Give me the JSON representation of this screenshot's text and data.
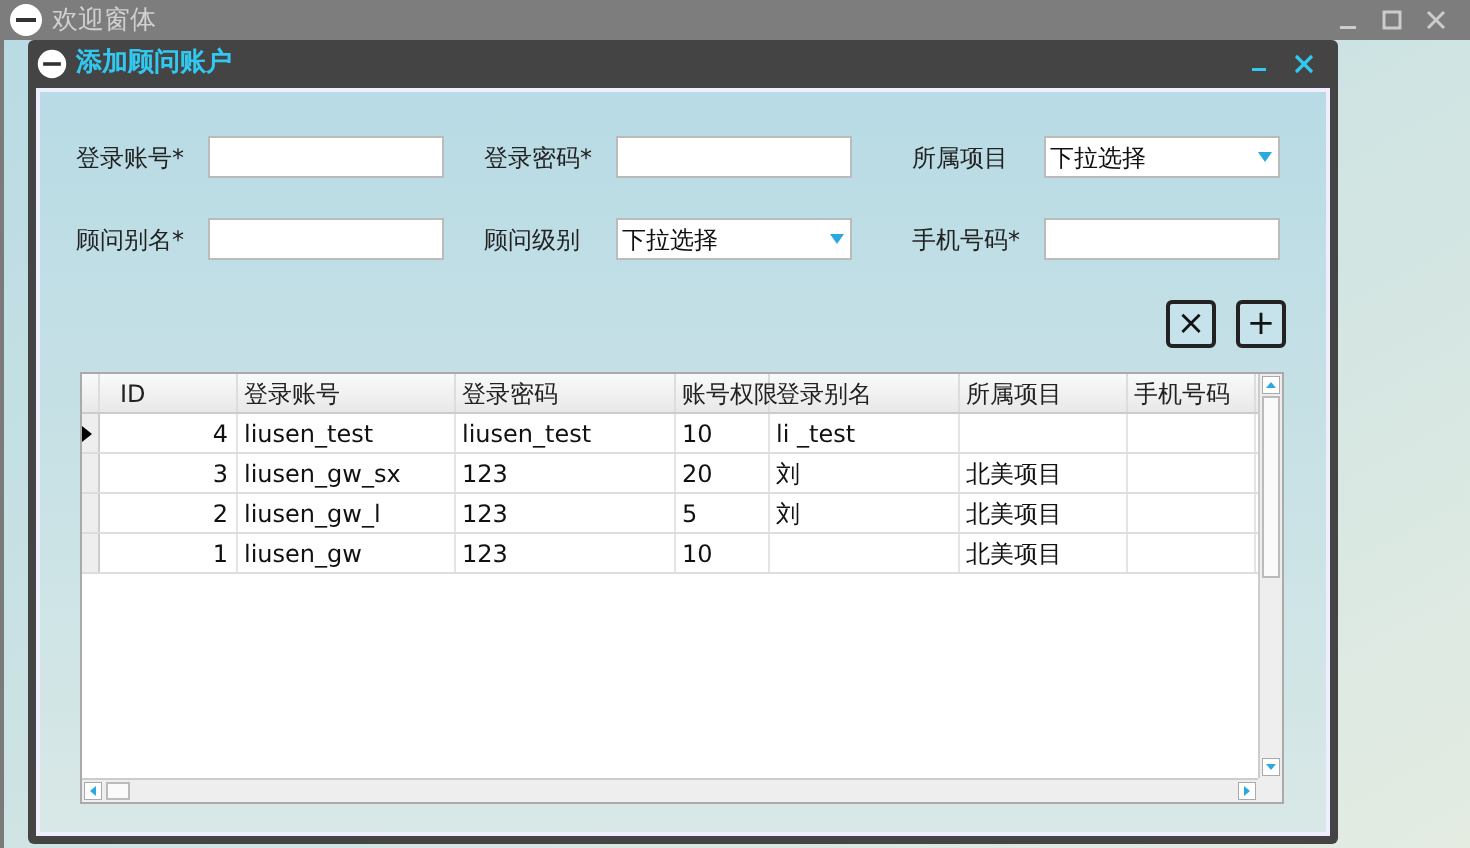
{
  "main_window": {
    "title": "欢迎窗体"
  },
  "dialog": {
    "title": "添加顾问账户"
  },
  "form_fields": [
    {
      "label": "登录账号*",
      "kind": "text"
    },
    {
      "label": "登录密码*",
      "kind": "text"
    },
    {
      "label": "所属项目",
      "kind": "dropdown",
      "value": "下拉选择"
    },
    {
      "label": "顾问别名*",
      "kind": "text"
    },
    {
      "label": "顾问级别",
      "kind": "dropdown",
      "value": "下拉选择"
    },
    {
      "label": "手机号码*",
      "kind": "text"
    }
  ],
  "action_buttons": [
    {
      "glyph": "×"
    },
    {
      "glyph": "+"
    }
  ],
  "table": {
    "columns": [
      "ID",
      "登录账号",
      "登录密码",
      "账号权限",
      "登录别名",
      "所属项目",
      "手机号码"
    ],
    "rows": [
      {
        "current": true,
        "cells": [
          "4",
          "liusen_test",
          "liusen_test",
          "10",
          "li _test",
          "",
          ""
        ]
      },
      {
        "current": false,
        "cells": [
          "3",
          "liusen_gw_sx",
          "123",
          "20",
          "刘",
          "北美项目",
          ""
        ]
      },
      {
        "current": false,
        "cells": [
          "2",
          "liusen_gw_l",
          "123",
          "5",
          "刘",
          "北美项目",
          ""
        ]
      },
      {
        "current": false,
        "cells": [
          "1",
          "liusen_gw",
          "123",
          "10",
          "",
          "北美项目",
          ""
        ]
      }
    ]
  }
}
